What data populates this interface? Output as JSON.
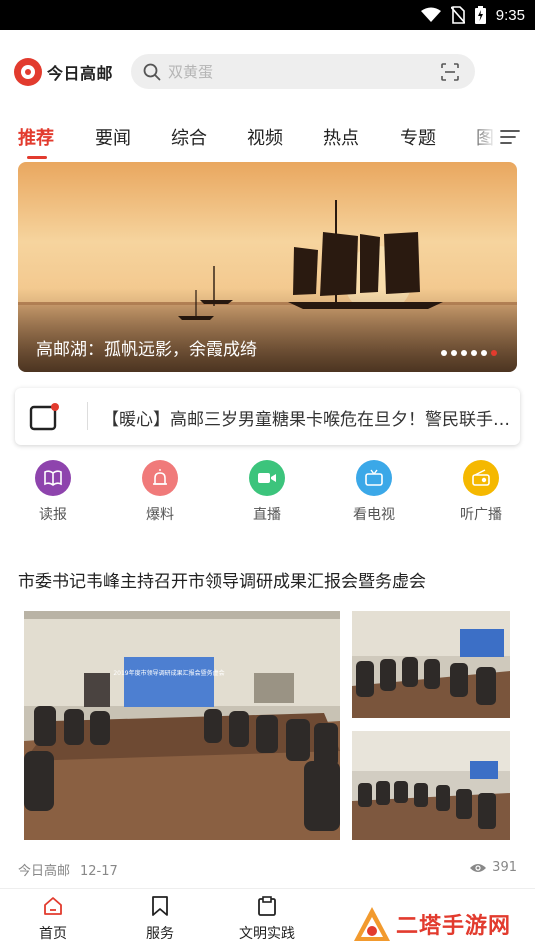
{
  "status_bar": {
    "time": "9:35"
  },
  "header": {
    "app_name": "今日高邮",
    "search_placeholder": "双黄蛋"
  },
  "tabs": [
    {
      "label": "推荐",
      "active": true
    },
    {
      "label": "要闻"
    },
    {
      "label": "综合"
    },
    {
      "label": "视频"
    },
    {
      "label": "热点"
    },
    {
      "label": "专题"
    },
    {
      "label": "图"
    }
  ],
  "banner": {
    "caption": "高邮湖：孤帆远影，余霞成绮",
    "dot_count": 6,
    "active_dot": 6
  },
  "ticker": {
    "text": "【暖心】高邮三岁男童糖果卡喉危在旦夕！警民联手紧急救助"
  },
  "quick_entries": [
    {
      "label": "读报",
      "color": "#8e44ad"
    },
    {
      "label": "爆料",
      "color": "#f07a7a"
    },
    {
      "label": "直播",
      "color": "#3cc47c"
    },
    {
      "label": "看电视",
      "color": "#3ba8e8"
    },
    {
      "label": "听广播",
      "color": "#f5b800"
    }
  ],
  "article": {
    "title": "市委书记韦峰主持召开市领导调研成果汇报会暨务虚会",
    "source": "今日高邮",
    "date": "12-17",
    "views": "391",
    "slide_text": "2019年度市领导调研成果汇报会暨务虚会"
  },
  "bottom_nav": [
    {
      "label": "首页",
      "active": true
    },
    {
      "label": "服务"
    },
    {
      "label": "文明实践"
    }
  ],
  "watermark": "二塔手游网",
  "colors": {
    "accent": "#e23b2e"
  }
}
